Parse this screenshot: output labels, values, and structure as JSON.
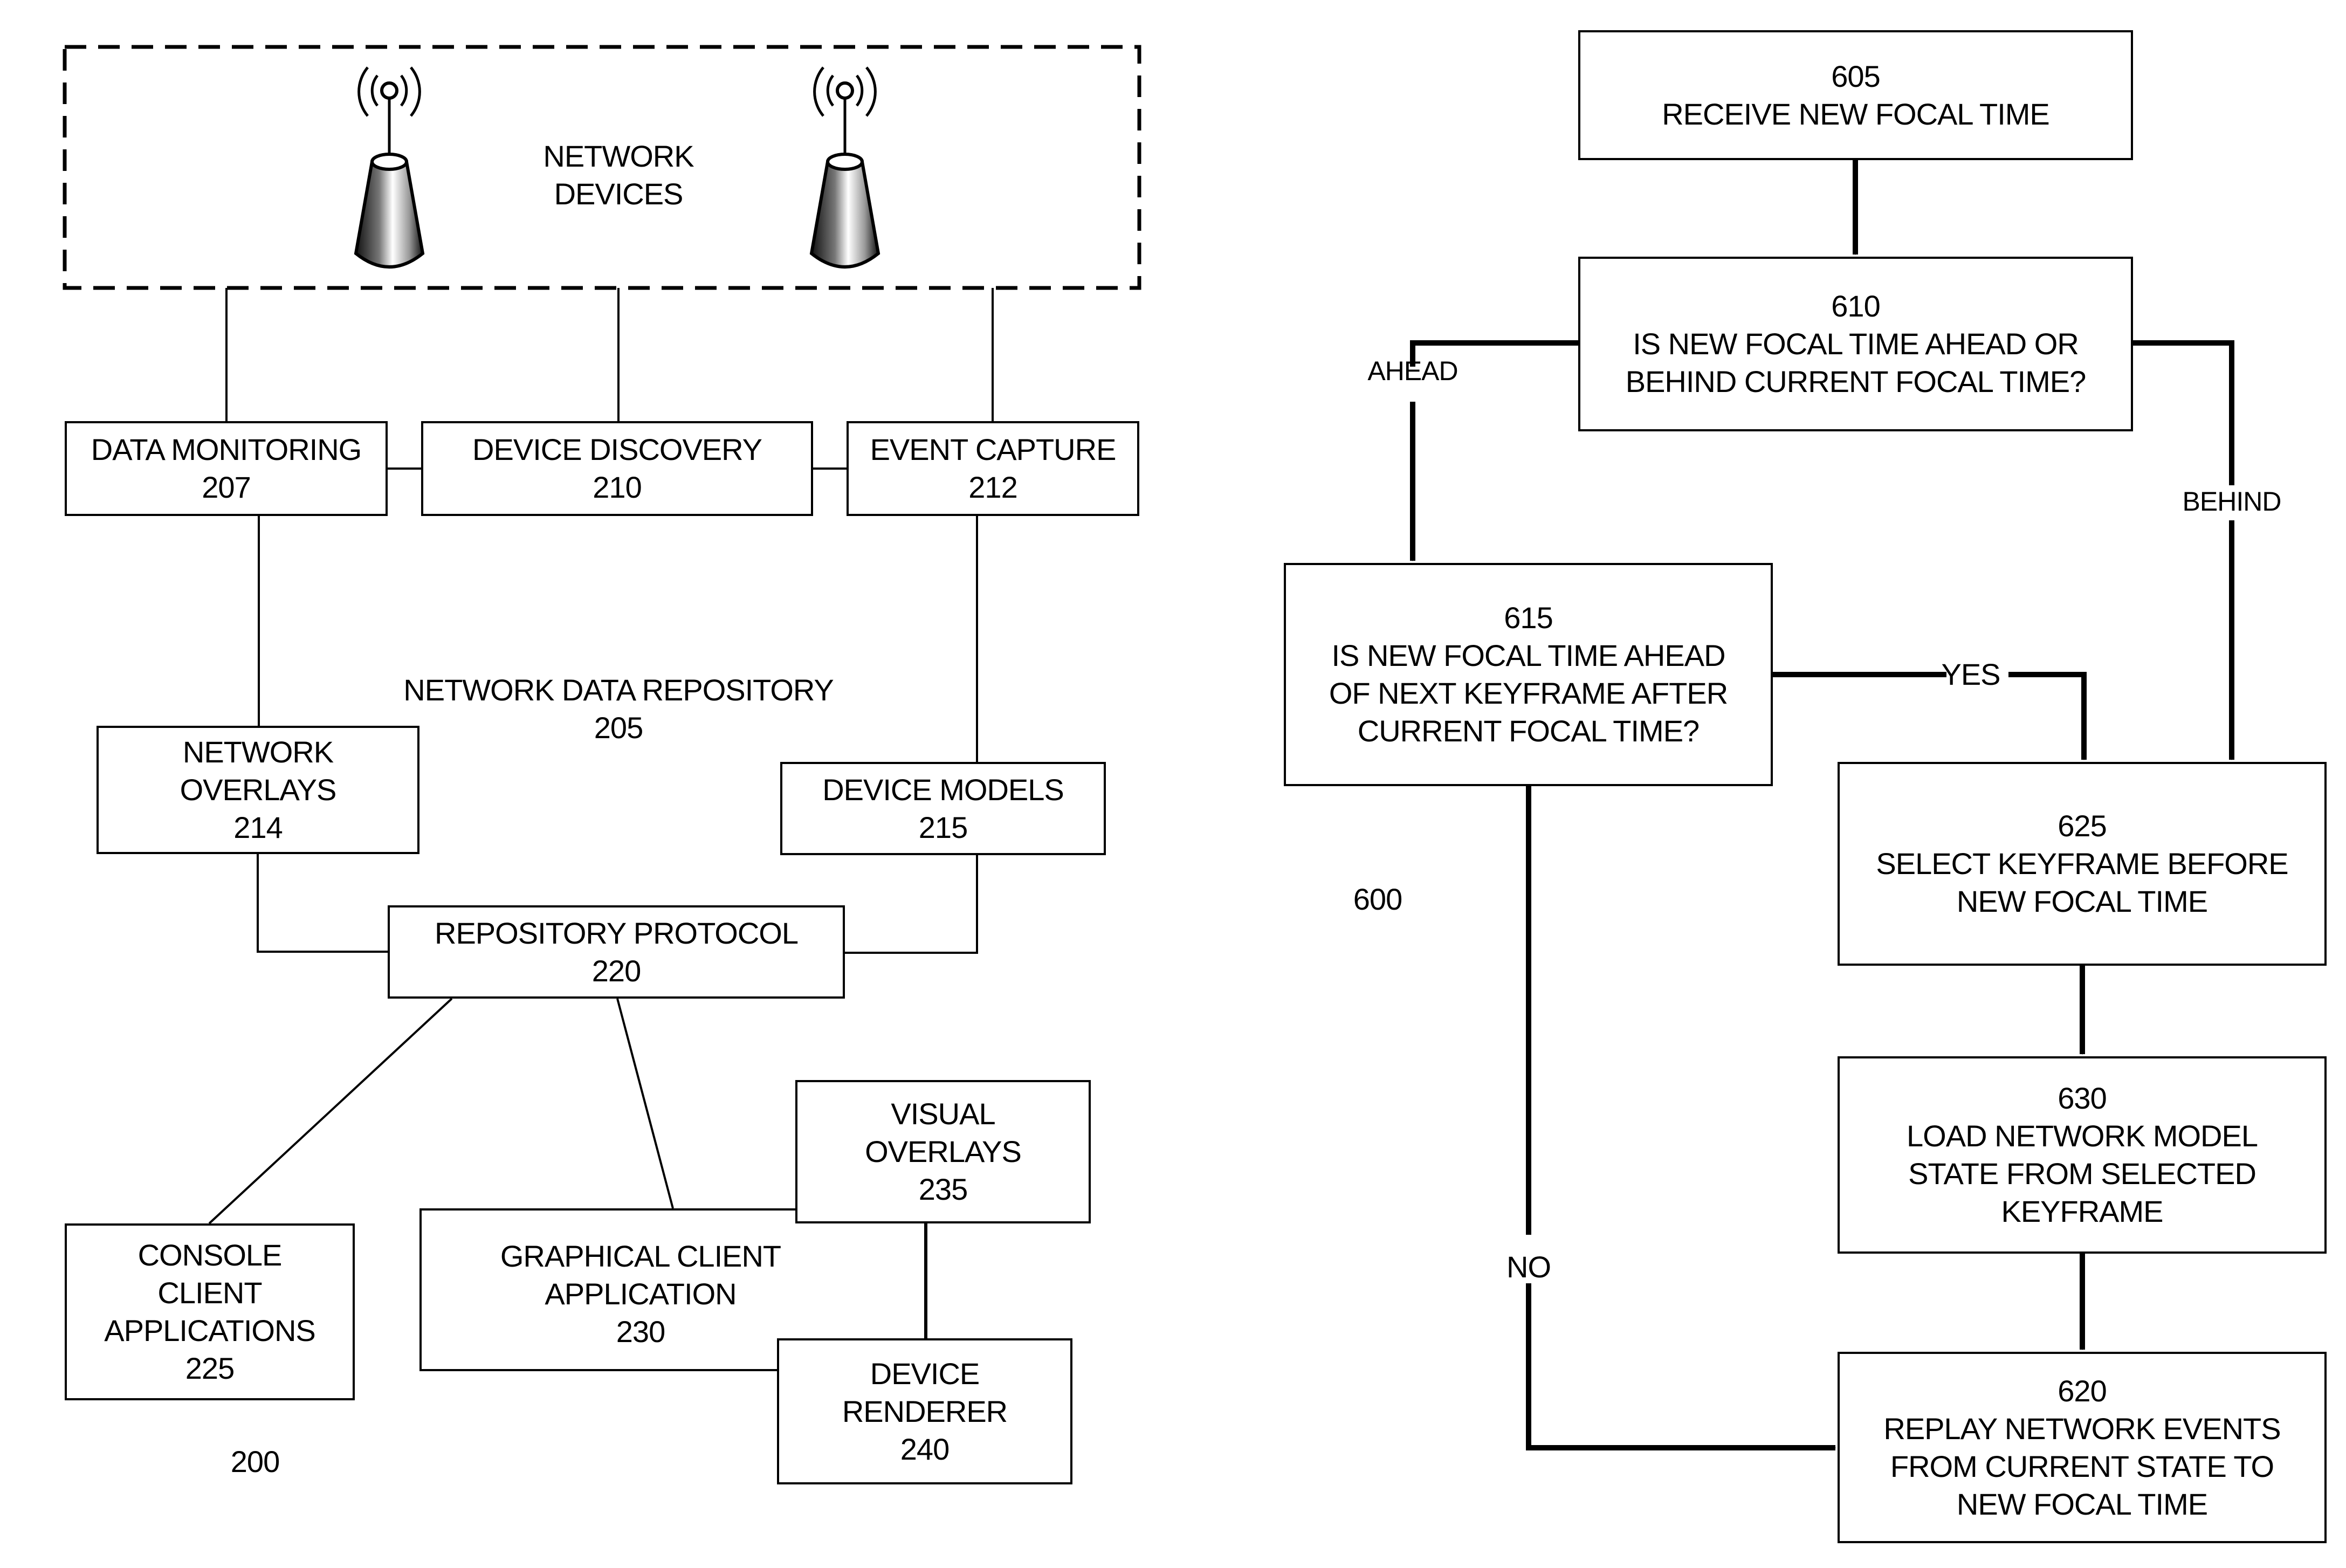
{
  "figure_left": {
    "id": "200",
    "network_devices": {
      "lines": [
        "NETWORK",
        "DEVICES"
      ],
      "icons": [
        "wireless-access-point-icon",
        "wireless-access-point-icon"
      ]
    },
    "repository": {
      "lines": [
        "NETWORK DATA REPOSITORY",
        "205"
      ]
    },
    "boxes": {
      "data_monitoring": [
        "DATA MONITORING",
        "207"
      ],
      "device_discovery": [
        "DEVICE DISCOVERY",
        "210"
      ],
      "event_capture": [
        "EVENT CAPTURE",
        "212"
      ],
      "network_overlays": [
        "NETWORK",
        "OVERLAYS",
        "214"
      ],
      "device_models": [
        "DEVICE MODELS",
        "215"
      ],
      "repository_protocol": [
        "REPOSITORY PROTOCOL",
        "220"
      ],
      "console_client": [
        "CONSOLE",
        "CLIENT",
        "APPLICATIONS",
        "225"
      ],
      "graphical_client": [
        "GRAPHICAL CLIENT",
        "APPLICATION",
        "230"
      ],
      "visual_overlays": [
        "VISUAL",
        "OVERLAYS",
        "235"
      ],
      "device_renderer": [
        "DEVICE",
        "RENDERER",
        "240"
      ]
    }
  },
  "figure_right": {
    "id": "600",
    "boxes": {
      "step_605": [
        "605",
        "RECEIVE NEW FOCAL TIME"
      ],
      "step_610": [
        "610",
        "IS NEW FOCAL TIME AHEAD OR",
        "BEHIND CURRENT FOCAL TIME?"
      ],
      "step_615": [
        "615",
        "IS NEW FOCAL TIME AHEAD",
        "OF NEXT KEYFRAME AFTER",
        "CURRENT FOCAL TIME?"
      ],
      "step_625": [
        "625",
        "SELECT KEYFRAME BEFORE",
        "NEW FOCAL TIME"
      ],
      "step_630": [
        "630",
        "LOAD NETWORK MODEL",
        "STATE FROM SELECTED",
        "KEYFRAME"
      ],
      "step_620": [
        "620",
        "REPLAY NETWORK EVENTS",
        "FROM CURRENT STATE TO",
        "NEW FOCAL TIME"
      ]
    },
    "edge_labels": {
      "ahead": "AHEAD",
      "behind": "BEHIND",
      "yes": "YES",
      "no": "NO"
    }
  }
}
